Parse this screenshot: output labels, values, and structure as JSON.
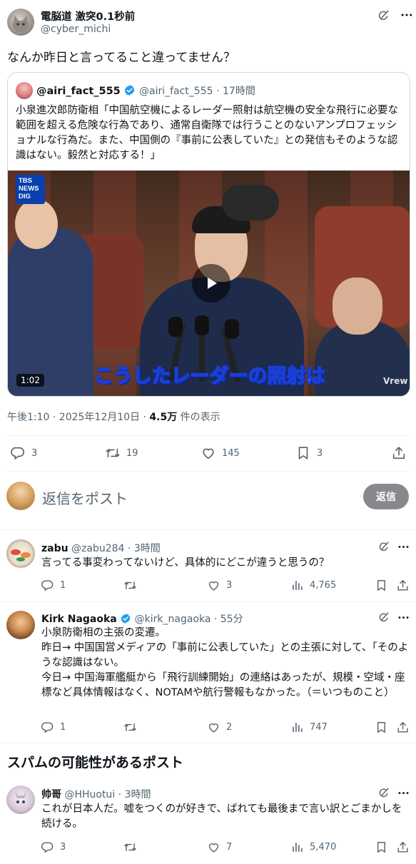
{
  "main_post": {
    "author_name": "電脳道 激突0.1秒前",
    "author_handle": "@cyber_michi",
    "text": "なんか昨日と言ってること違ってません？",
    "quote": {
      "author_name": "@airi_fact_555",
      "author_handle": "@airi_fact_555",
      "time": "· 17時間",
      "text": "小泉進次郎防衛相「中国航空機によるレーダー照射は航空機の安全な飛行に必要な範囲を超える危険な行為であり、通常自衛隊では行うことのないアンプロフェッショナルな行為だ。また、中国側の『事前に公表していた』との発信もそのような認識はない。毅然と対応する！」",
      "video": {
        "logo_line1": "TBS",
        "logo_line2": "NEWS",
        "logo_line3": "DIG",
        "subtitle": "こうしたレーダーの照射は",
        "duration": "1:02",
        "watermark": "Vrew"
      }
    },
    "timestamp": "午後1:10 · 2025年12月10日 · ",
    "views_count": "4.5万",
    "views_label": " 件の表示",
    "replies": "3",
    "reposts": "19",
    "likes": "145",
    "bookmarks": "3"
  },
  "reply_box": {
    "placeholder": "返信をポスト",
    "button_label": "返信"
  },
  "replies": [
    {
      "name": "zabu",
      "handle": "@zabu284",
      "time": "· 3時間",
      "text": "言ってる事変わってないけど、具体的にどこが違うと思うの？",
      "replies": "1",
      "reposts": "",
      "likes": "3",
      "views": "4,765"
    },
    {
      "name": "Kirk Nagaoka",
      "handle": "@kirk_nagaoka",
      "time": "· 55分",
      "text_lines": [
        "小泉防衛相の主張の変遷。",
        "昨日→ 中国国営メディアの「事前に公表していた」との主張に対して、「そのような認識はない。",
        "今日→ 中国海軍艦艇から「飛行訓練開始」の連絡はあったが、規模・空域・座標など具体情報はなく、NOTAMや航行警報もなかった。（＝いつものこと）"
      ],
      "replies": "1",
      "reposts": "",
      "likes": "2",
      "views": "747"
    }
  ],
  "spam_section": {
    "heading": "スパムの可能性があるポスト"
  },
  "spam_reply": {
    "name": "帅哥",
    "handle": "@HHuotui",
    "time": "· 3時間",
    "text": "これが日本人だ。嘘をつくのが好きで、ばれても最後まで言い訳とごまかしを続ける。",
    "replies": "3",
    "reposts": "",
    "likes": "7",
    "views": "5,470"
  },
  "colors": {
    "accent": "#1d9bf0",
    "text": "#0f1419",
    "muted": "#536471",
    "border": "#eff3f4",
    "button_bg": "#87898c"
  }
}
